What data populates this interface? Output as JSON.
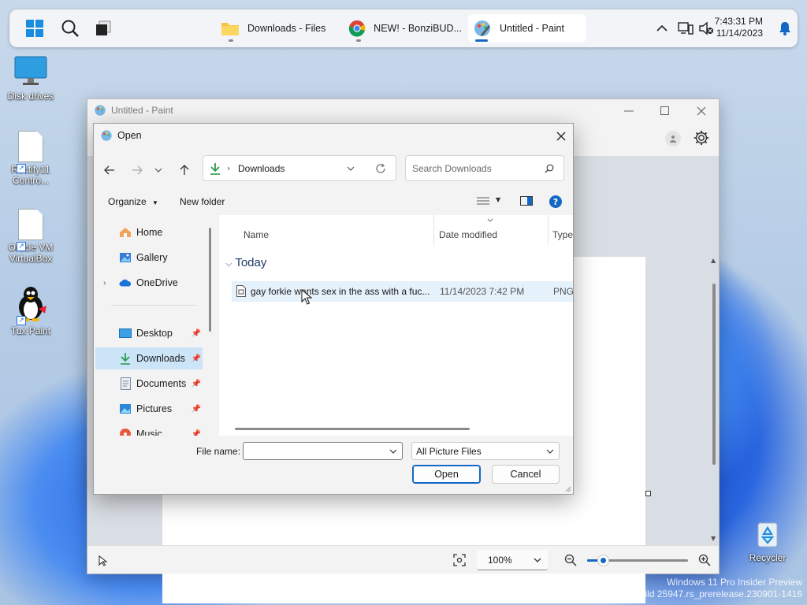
{
  "taskbar": {
    "apps": [
      {
        "label": "Downloads - Files",
        "icon": "folder-icon",
        "active": false
      },
      {
        "label": "NEW! - BonziBUD...",
        "icon": "chrome-icon",
        "active": false
      },
      {
        "label": "Untitled - Paint",
        "icon": "paint-icon",
        "active": true
      }
    ],
    "time": "7:43:31 PM",
    "date": "11/14/2023"
  },
  "desktop": {
    "icons": [
      {
        "label": "Disk drives"
      },
      {
        "label": "Rectify11 Contro..."
      },
      {
        "label": "Oracle VM VirtualBox"
      },
      {
        "label": "Tux Paint"
      },
      {
        "label": "Recycler"
      }
    ]
  },
  "paint": {
    "title": "Untitled - Paint",
    "zoom": "100%"
  },
  "dialog": {
    "title": "Open",
    "address": "Downloads",
    "search_placeholder": "Search Downloads",
    "organize_label": "Organize",
    "new_folder_label": "New folder",
    "nav": [
      {
        "label": "Home"
      },
      {
        "label": "Gallery"
      },
      {
        "label": "OneDrive"
      },
      {
        "label": "Desktop"
      },
      {
        "label": "Downloads"
      },
      {
        "label": "Documents"
      },
      {
        "label": "Pictures"
      },
      {
        "label": "Music"
      }
    ],
    "columns": {
      "name": "Name",
      "date": "Date modified",
      "type": "Type"
    },
    "group_label": "Today",
    "files": [
      {
        "name": "gay forkie wants sex in the ass with a fuc...",
        "date": "11/14/2023 7:42 PM",
        "type": "PNG"
      }
    ],
    "filename_label": "File name:",
    "filename_value": "",
    "filter": "All Picture Files",
    "open_label": "Open",
    "cancel_label": "Cancel"
  },
  "watermark": {
    "line1": "Windows 11 Pro Insider Preview",
    "line2": "Evaluation copy. Build 25947.rs_prerelease.230901-1416"
  },
  "colors": {
    "accent": "#1467c5",
    "selection": "#cce4f7"
  }
}
